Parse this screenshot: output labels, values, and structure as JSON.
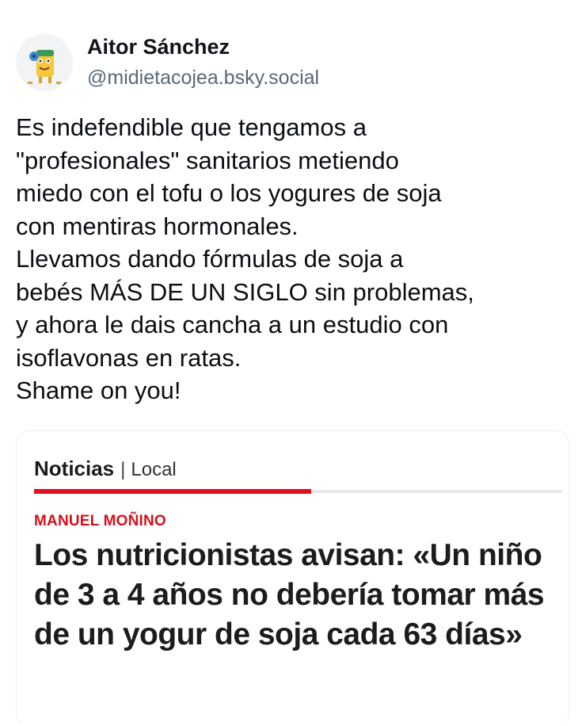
{
  "author": {
    "name": "Aitor Sánchez",
    "handle": "@midietacojea.bsky.social",
    "avatar_icon": "cartoon-avatar"
  },
  "post": {
    "lines": [
      "Es indefendible que tengamos a",
      "\"profesionales\" sanitarios metiendo",
      "miedo con el tofu o los yogures de soja",
      "con mentiras hormonales.",
      "Llevamos dando fórmulas de soja a",
      "bebés MÁS DE UN SIGLO sin problemas,",
      "y ahora le dais cancha a un estudio con",
      "isoflavonas en ratas.",
      "Shame on you!"
    ]
  },
  "embed": {
    "section": "Noticias",
    "separator": "|",
    "subsection": "Local",
    "byline": "MANUEL MOÑINO",
    "headline": "Los nutricionistas avisan: «Un niño de 3 a 4 años no debería tomar más de un yogur de soja cada 63 días»"
  },
  "colors": {
    "text": "#0b0f14",
    "handle": "#5b6876",
    "accent_red": "#e0101c",
    "byline_red": "#d3111d"
  }
}
